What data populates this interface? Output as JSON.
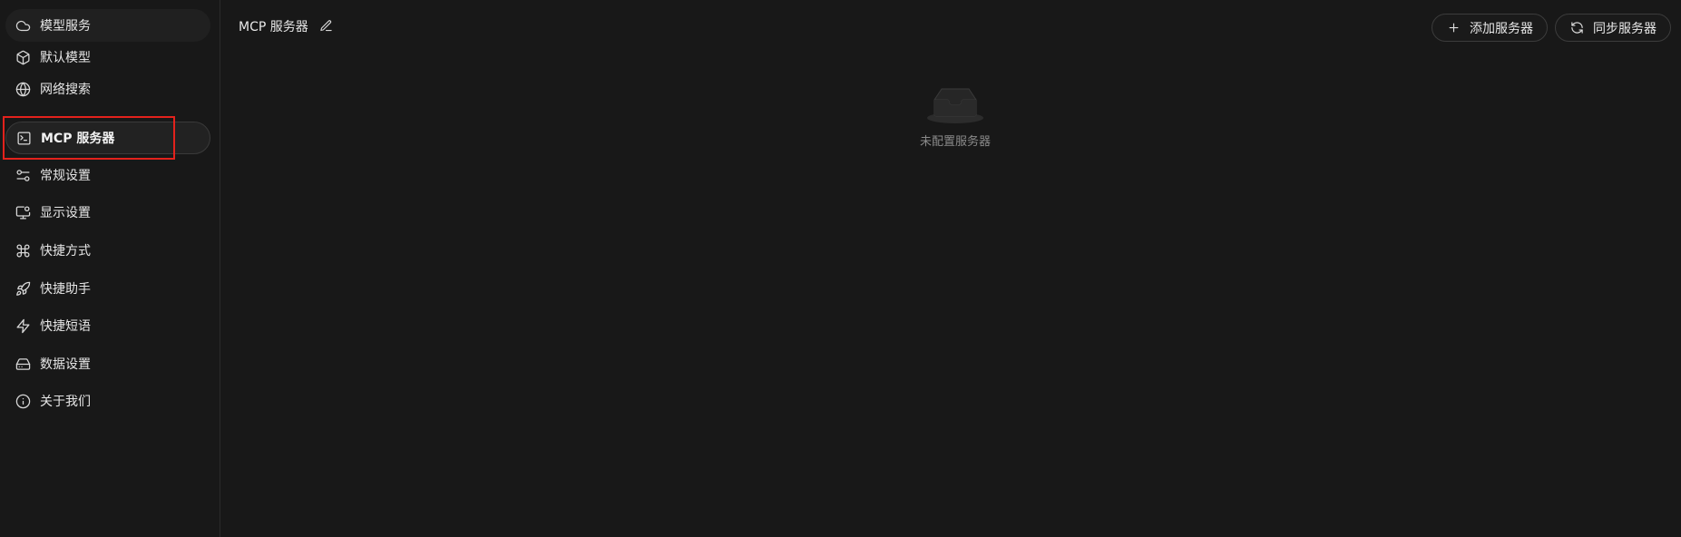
{
  "sidebar": {
    "items": [
      {
        "label": "模型服务",
        "icon": "cloud-icon"
      },
      {
        "label": "默认模型",
        "icon": "cube-icon"
      },
      {
        "label": "网络搜索",
        "icon": "globe-icon"
      },
      {
        "label": "MCP 服务器",
        "icon": "terminal-icon",
        "active": true
      },
      {
        "label": "常规设置",
        "icon": "sliders-icon"
      },
      {
        "label": "显示设置",
        "icon": "monitor-settings-icon"
      },
      {
        "label": "快捷方式",
        "icon": "command-icon"
      },
      {
        "label": "快捷助手",
        "icon": "rocket-icon"
      },
      {
        "label": "快捷短语",
        "icon": "zap-icon"
      },
      {
        "label": "数据设置",
        "icon": "hard-drive-icon"
      },
      {
        "label": "关于我们",
        "icon": "info-icon"
      }
    ]
  },
  "header": {
    "title": "MCP 服务器",
    "add_label": "添加服务器",
    "sync_label": "同步服务器"
  },
  "empty_state": {
    "text": "未配置服务器"
  },
  "colors": {
    "background": "#181818",
    "highlight": "#e3221c",
    "muted_text": "#8a8a8a"
  }
}
